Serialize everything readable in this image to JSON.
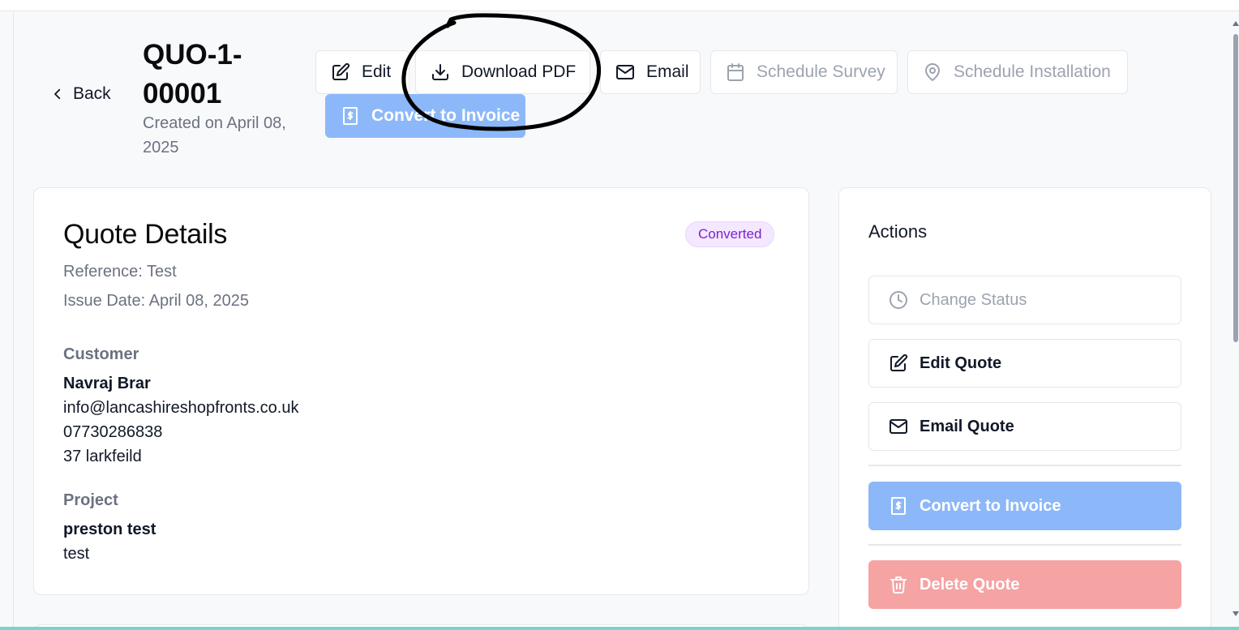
{
  "header": {
    "back_label": "Back",
    "title": "QUO-1-00001",
    "created": "Created on April 08, 2025"
  },
  "toolbar": {
    "edit_label": "Edit",
    "download_label": "Download PDF",
    "email_label": "Email",
    "schedule_survey_label": "Schedule Survey",
    "schedule_installation_label": "Schedule Installation",
    "convert_label": "Convert to Invoice"
  },
  "quote": {
    "heading": "Quote Details",
    "status": "Converted",
    "reference": "Reference: Test",
    "issue_date": "Issue Date: April 08, 2025",
    "customer_label": "Customer",
    "customer_name": "Navraj Brar",
    "customer_email": "info@lancashireshopfronts.co.uk",
    "customer_phone": "07730286838",
    "customer_address": "37 larkfeild",
    "project_label": "Project",
    "project_name": "preston test",
    "project_desc": "test"
  },
  "actions": {
    "heading": "Actions",
    "change_status": "Change Status",
    "edit_quote": "Edit Quote",
    "email_quote": "Email Quote",
    "convert_invoice": "Convert to Invoice",
    "delete_quote": "Delete Quote"
  },
  "colors": {
    "primary_disabled": "#8cb8f9",
    "danger_disabled": "#f5a3a3",
    "badge_text": "#7e22ce",
    "badge_bg": "#f3e8ff"
  }
}
